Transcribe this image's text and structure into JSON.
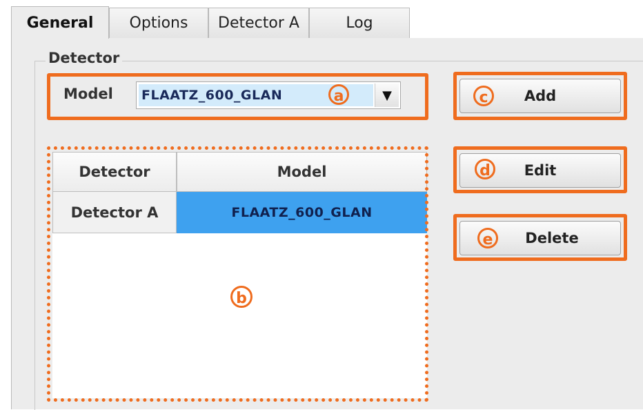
{
  "tabs": [
    {
      "label": "General",
      "active": true
    },
    {
      "label": "Options",
      "active": false
    },
    {
      "label": "Detector A",
      "active": false
    },
    {
      "label": "Log",
      "active": false
    }
  ],
  "group": {
    "title": "Detector"
  },
  "model_field": {
    "label": "Model",
    "value": "FLAATZ_600_GLAN",
    "dropdown_glyph": "▼"
  },
  "table": {
    "columns": [
      "Detector",
      "Model"
    ],
    "rows": [
      {
        "detector": "Detector A",
        "model": "FLAATZ_600_GLAN",
        "selected": true
      }
    ]
  },
  "buttons": {
    "add": "Add",
    "edit": "Edit",
    "delete": "Delete"
  },
  "callouts": {
    "a": "ⓐ",
    "b": "ⓑ",
    "c": "ⓒ",
    "d": "ⓓ",
    "e": "ⓔ"
  },
  "colors": {
    "accent": "#ef6c1e",
    "selection": "#3ea1ef",
    "combo_highlight": "#d3ebfb"
  }
}
